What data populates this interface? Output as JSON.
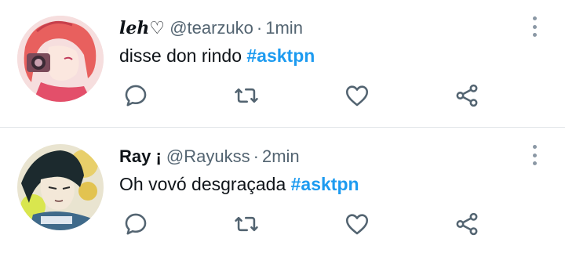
{
  "tweets": [
    {
      "display_name": "leh♡",
      "handle": "@tearzuko",
      "separator": "·",
      "time": "1min",
      "text": "disse don rindo ",
      "hashtag": "#asktpn",
      "avatar_icon": "avatar-red-haired-girl-with-camera",
      "actions": [
        "reply-icon",
        "retweet-icon",
        "like-icon",
        "share-icon"
      ]
    },
    {
      "display_name": "Ray ¡",
      "handle": "@Rayukss",
      "separator": "·",
      "time": "2min",
      "text": "Oh vovó desgraçada ",
      "hashtag": "#asktpn",
      "avatar_icon": "avatar-dark-haired-anime-boy",
      "actions": [
        "reply-icon",
        "retweet-icon",
        "like-icon",
        "share-icon"
      ]
    }
  ],
  "colors": {
    "text": "#0f1419",
    "secondary": "#536471",
    "hashtag": "#1d9bf0",
    "icon": "#536471",
    "divider": "#e1e5e9"
  }
}
